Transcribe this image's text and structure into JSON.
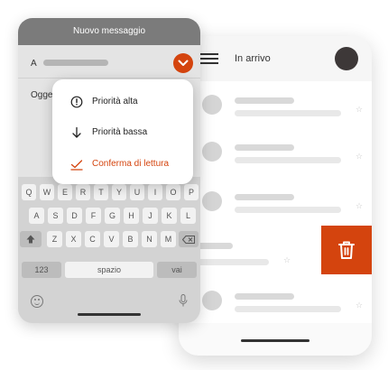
{
  "colors": {
    "accent": "#d4440e",
    "header_gray": "#7b7b7b",
    "avatar_dark": "#3d3838"
  },
  "inbox": {
    "title": "In arrivo",
    "menu_icon": "hamburger-icon",
    "rows": [
      {
        "star": "☆"
      },
      {
        "star": "☆"
      },
      {
        "star": "☆"
      },
      {
        "star": "☆",
        "swiped": true,
        "action_icon": "trash-icon"
      },
      {
        "star": "☆"
      }
    ]
  },
  "compose": {
    "title": "Nuovo messaggio",
    "to_label": "A",
    "subject_label": "Oggetto:",
    "expand_icon": "chevron-down-icon"
  },
  "priority_menu": {
    "items": [
      {
        "label": "Priorità alta",
        "icon": "exclamation-circle-icon"
      },
      {
        "label": "Priorità bassa",
        "icon": "arrow-down-icon"
      },
      {
        "label": "Conferma di lettura",
        "icon": "checkmark-icon",
        "accent": true
      }
    ]
  },
  "keyboard": {
    "row1": [
      "Q",
      "W",
      "E",
      "R",
      "T",
      "Y",
      "U",
      "I",
      "O",
      "P"
    ],
    "row2": [
      "A",
      "S",
      "D",
      "F",
      "G",
      "H",
      "J",
      "K",
      "L"
    ],
    "row3": [
      "Z",
      "X",
      "C",
      "V",
      "B",
      "N",
      "M"
    ],
    "shift_icon": "shift-icon",
    "backspace_icon": "backspace-icon",
    "numbers_label": "123",
    "space_label": "spazio",
    "go_label": "vai",
    "emoji_icon": "emoji-icon",
    "mic_icon": "microphone-icon"
  }
}
